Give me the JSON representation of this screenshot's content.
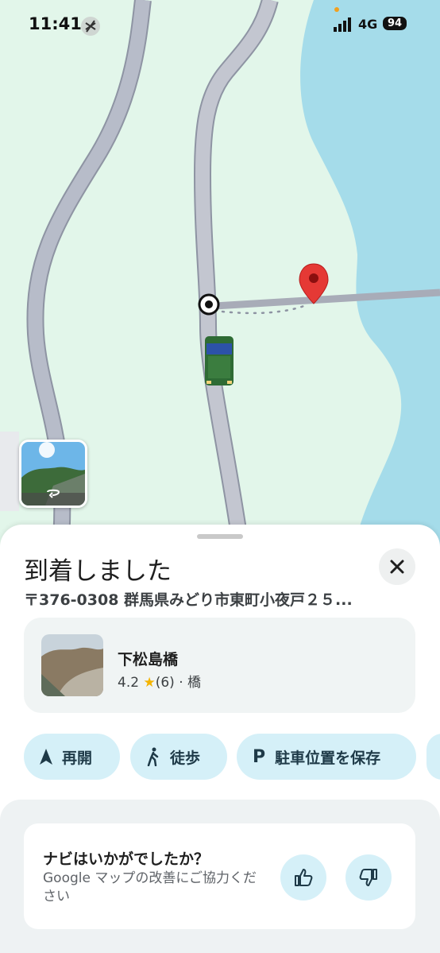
{
  "status_bar": {
    "time": "11:41",
    "network": "4G",
    "battery": "94"
  },
  "map": {
    "colors": {
      "land": "#e2f6ea",
      "water": "#a5dcea",
      "road": "#b7bcc9",
      "road_outline": "#8e94a3"
    }
  },
  "sheet": {
    "title": "到着しました",
    "address": "〒376-0308 群馬県みどり市東町小夜戸２５...",
    "place": {
      "name": "下松島橋",
      "rating": "4.2",
      "star": "★",
      "reviews": "(6)",
      "separator": "·",
      "category": "橋"
    },
    "chips": [
      {
        "label": "再開",
        "icon": "navigation-arrow-icon"
      },
      {
        "label": "徒歩",
        "icon": "walking-icon"
      },
      {
        "label": "駐車位置を保存",
        "icon": "parking-icon"
      }
    ],
    "feedback": {
      "question": "ナビはいかがでしたか？",
      "subtitle": "Google マップの改善にご協力ください"
    }
  }
}
